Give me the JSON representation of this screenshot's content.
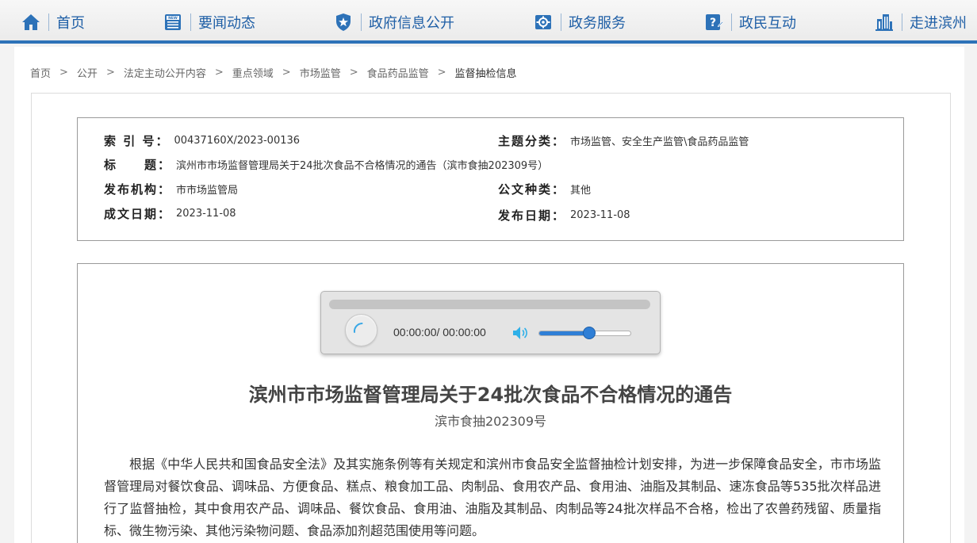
{
  "nav": {
    "items": [
      {
        "label": "首页",
        "icon": "home-icon"
      },
      {
        "label": "要闻动态",
        "icon": "news-icon"
      },
      {
        "label": "政府信息公开",
        "icon": "shield-star-icon"
      },
      {
        "label": "政务服务",
        "icon": "service-gear-icon"
      },
      {
        "label": "政民互动",
        "icon": "question-edit-icon"
      },
      {
        "label": "走进滨州",
        "icon": "buildings-icon"
      }
    ]
  },
  "breadcrumb": {
    "items": [
      "首页",
      "公开",
      "法定主动公开内容",
      "重点领域",
      "市场监管",
      "食品药品监管",
      "监督抽检信息"
    ],
    "separator": ">"
  },
  "meta": {
    "index_label": "索 引 号：",
    "index_value": "00437160X/2023-00136",
    "topic_label": "主题分类：",
    "topic_value": "市场监管、安全生产监管\\食品药品监管",
    "title_label": "标　　题：",
    "title_value": "滨州市市场监督管理局关于24批次食品不合格情况的通告（滨市食抽202309号）",
    "org_label": "发布机构：",
    "org_value": "市市场监管局",
    "doctype_label": "公文种类：",
    "doctype_value": "其他",
    "written_label": "成文日期：",
    "written_value": "2023-11-08",
    "published_label": "发布日期：",
    "published_value": "2023-11-08"
  },
  "player": {
    "time": "00:00:00/ 00:00:00",
    "progress": 0,
    "volume": 0.55
  },
  "article": {
    "title": "滨州市市场监督管理局关于24批次食品不合格情况的通告",
    "subtitle": "滨市食抽202309号",
    "body": "根据《中华人民共和国食品安全法》及其实施条例等有关规定和滨州市食品安全监督抽检计划安排，为进一步保障食品安全，市市场监督管理局对餐饮食品、调味品、方便食品、糕点、粮食加工品、肉制品、食用农产品、食用油、油脂及其制品、速冻食品等535批次样品进行了监督抽检，其中食用农产品、调味品、餐饮食品、食用油、油脂及其制品、肉制品等24批次样品不合格，检出了农兽药残留、质量指标、微生物污染、其他污染物问题、食品添加剂超范围使用等问题。"
  },
  "colors": {
    "nav_text": "#1f5fa6",
    "nav_border": "#2d72b8",
    "player_accent": "#2f7fd6"
  }
}
